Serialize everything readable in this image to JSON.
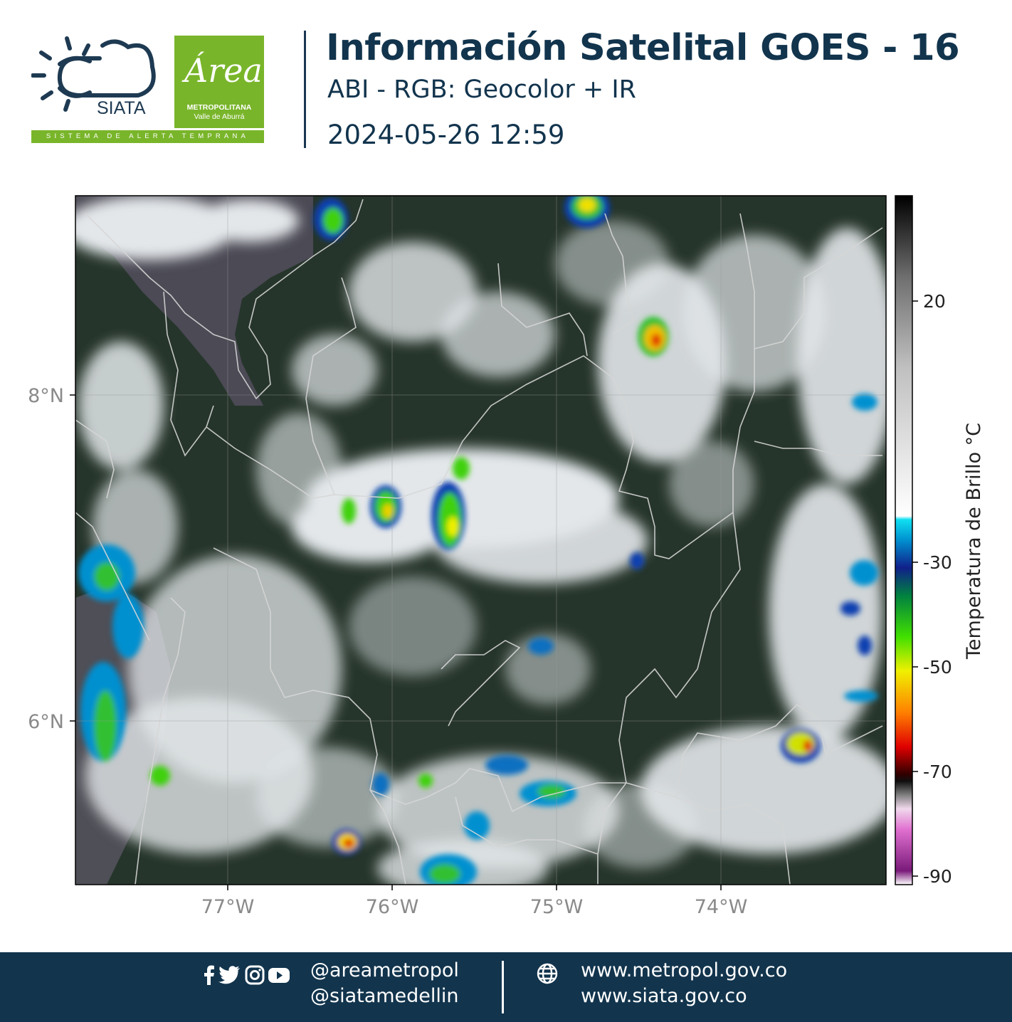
{
  "header": {
    "logo_siata_text": "SIATA",
    "logo_siata_tagline": "SISTEMA DE ALERTA TEMPRANA",
    "logo_area_script": "Área",
    "logo_area_line1": "METROPOLITANA",
    "logo_area_line2": "Valle de Aburrá",
    "title": "Información Satelital GOES - 16",
    "subtitle": "ABI - RGB: Geocolor + IR",
    "datetime": "2024-05-26 12:59"
  },
  "map": {
    "lat_ticks": [
      "8°N",
      "6°N"
    ],
    "lon_ticks": [
      "77°W",
      "76°W",
      "75°W",
      "74°W"
    ],
    "lon_values": [
      -77,
      -76,
      -75,
      -74
    ],
    "lat_values": [
      8,
      6
    ],
    "extent": {
      "lon_min": -77.93,
      "lon_max": -72.97,
      "lat_min": 5.0,
      "lat_max": 9.23
    }
  },
  "colorbar": {
    "label": "Temperatura de Brillo °C",
    "ticks": [
      "20",
      "-30",
      "-50",
      "-70",
      "-90"
    ],
    "tick_values": [
      20,
      -30,
      -50,
      -70,
      -90
    ],
    "range": [
      -92,
      40
    ]
  },
  "footer": {
    "handle_1": "@areametropol",
    "handle_2": "@siatamedellin",
    "url_1": "www.metropol.gov.co",
    "url_2": "www.siata.gov.co",
    "icons": [
      "facebook-icon",
      "twitter-icon",
      "instagram-icon",
      "youtube-icon",
      "globe-icon"
    ]
  },
  "colors": {
    "brand_navy": "#12344d",
    "brand_green": "#79b52a",
    "map_land": "#24332a",
    "cloud": "#e6e9ec"
  }
}
